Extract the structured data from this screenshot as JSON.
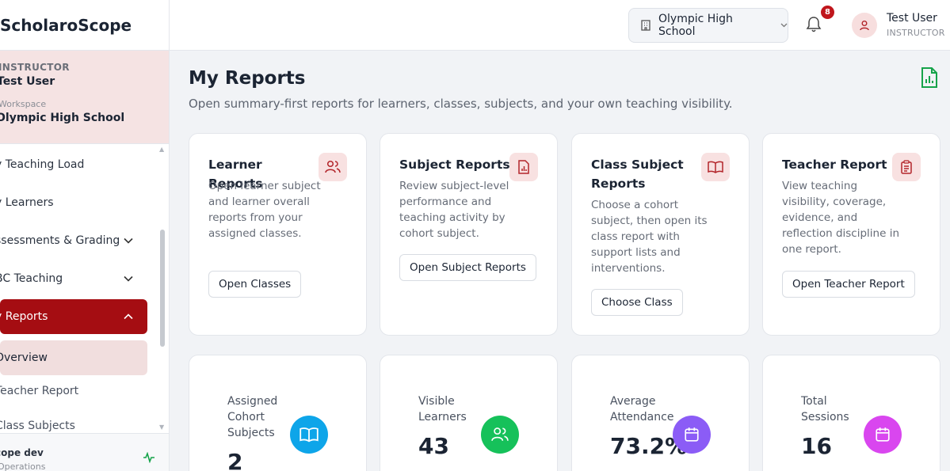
{
  "app": {
    "name": "ScholaroScope"
  },
  "sidebar": {
    "user": {
      "role": "INSTRUCTOR",
      "name": "Test User",
      "workspace_label": "Workspace",
      "workspace": "Olympic High School"
    },
    "items": [
      {
        "label": "y Teaching Load"
      },
      {
        "label": "y Learners"
      },
      {
        "label": "ssessments & Grading"
      },
      {
        "label": "BC Teaching"
      },
      {
        "label": "y Reports"
      },
      {
        "label": "Overview"
      },
      {
        "label": "Teacher Report"
      },
      {
        "label": "Class Subjects"
      }
    ],
    "footer": {
      "title": "cope dev",
      "subtitle": "Operations"
    }
  },
  "topbar": {
    "school": "Olympic High School",
    "notifications_count": "8",
    "user_name": "Test User",
    "user_role": "INSTRUCTOR"
  },
  "main": {
    "title": "My Reports",
    "subtitle": "Open summary-first reports for learners, classes, subjects, and your own teaching visibility.",
    "cards": [
      {
        "title": "Learner Reports",
        "description": "Open learner subject and learner overall reports from your assigned classes.",
        "button": "Open Classes",
        "icon": "users-icon"
      },
      {
        "title": "Subject Reports",
        "description": "Review subject-level performance and teaching activity by cohort subject.",
        "button": "Open Subject Reports",
        "icon": "file-chart-icon"
      },
      {
        "title": "Class Subject Reports",
        "description": "Choose a cohort subject, then open its class report with support lists and interventions.",
        "button": "Choose Class",
        "icon": "book-icon"
      },
      {
        "title": "Teacher Report",
        "description": "View teaching visibility, coverage, evidence, and reflection discipline in one report.",
        "button": "Open Teacher Report",
        "icon": "clipboard-icon"
      }
    ],
    "stats": [
      {
        "label": "Assigned Cohort Subjects",
        "value": "2",
        "icon": "book-icon",
        "color": "#0ea5e9"
      },
      {
        "label": "Visible Learners",
        "value": "43",
        "icon": "users-icon",
        "color": "#16c15a"
      },
      {
        "label": "Average Attendance",
        "value": "73.2%",
        "icon": "calendar-icon",
        "color": "#8b5cf6"
      },
      {
        "label": "Total Sessions",
        "value": "16",
        "icon": "calendar-icon",
        "color": "#d946ef"
      }
    ]
  },
  "colors": {
    "accent": "#a50d12",
    "accent_soft": "#f8e1e1",
    "export_green": "#16a34a"
  }
}
